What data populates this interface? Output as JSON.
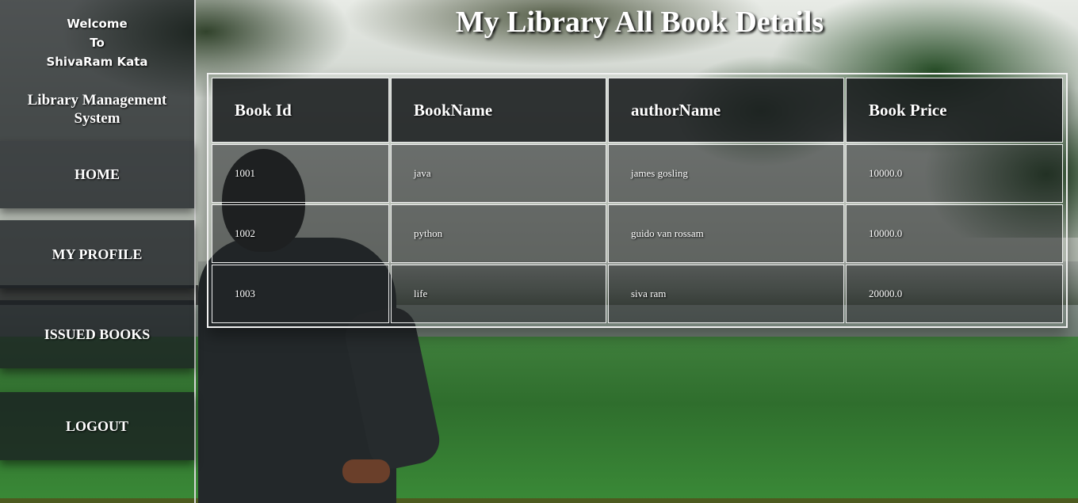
{
  "sidebar": {
    "welcome_line1": "Welcome",
    "welcome_line2": "To",
    "welcome_line3": "ShivaRam Kata",
    "app_title_line1": "Library Management",
    "app_title_line2": "System",
    "nav": {
      "home": "HOME",
      "profile": "MY PROFILE",
      "issued": "ISSUED BOOKS",
      "logout": "LOGOUT"
    }
  },
  "main": {
    "title": "My Library All Book Details",
    "table": {
      "headers": [
        "Book Id",
        "BookName",
        "authorName",
        "Book Price"
      ],
      "rows": [
        [
          "1001",
          "java",
          "james gosling",
          "10000.0"
        ],
        [
          "1002",
          "python",
          "guido van rossam",
          "10000.0"
        ],
        [
          "1003",
          "life",
          "siva ram",
          "20000.0"
        ]
      ]
    }
  }
}
